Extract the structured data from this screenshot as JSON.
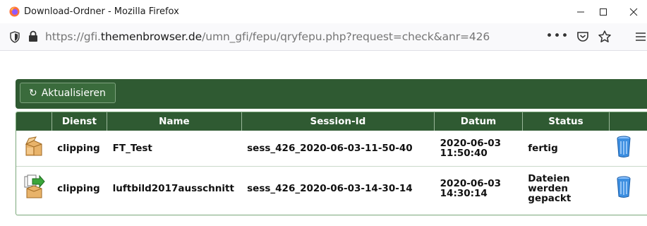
{
  "window": {
    "title": "Download-Ordner - Mozilla Firefox",
    "controls": {
      "minimize": "—",
      "maximize": "☐",
      "close": "✕"
    }
  },
  "urlbar": {
    "url_prefix": "https://gfi.",
    "url_domain": "themenbrowser.de",
    "url_path": "/umn_gfi/fepu/qryfepu.php?request=check&anr=426",
    "more": "•••",
    "pocket_icon": "pocket-icon",
    "star_icon": "star-icon",
    "menu_icon": "hamburger-menu-icon"
  },
  "toolbar": {
    "refresh_label": "Aktualisieren",
    "refresh_icon": "↻"
  },
  "table": {
    "headers": [
      "",
      "Dienst",
      "Name",
      "Session-Id",
      "Datum",
      "Status",
      ""
    ],
    "rows": [
      {
        "icon": "package-icon",
        "dienst": "clipping",
        "name": "FT_Test",
        "session_id": "sess_426_2020-06-03-11-50-40",
        "datum_date": "2020-06-03",
        "datum_time": "11:50:40",
        "status_lines": [
          "fertig",
          "",
          ""
        ],
        "delete_icon": "trash-icon"
      },
      {
        "icon": "packing-in-progress-icon",
        "dienst": "clipping",
        "name": "luftbild2017ausschnitt",
        "session_id": "sess_426_2020-06-03-14-30-14",
        "datum_date": "2020-06-03",
        "datum_time": "14:30:14",
        "status_lines": [
          "Dateien",
          "werden",
          "gepackt"
        ],
        "delete_icon": "trash-icon"
      }
    ]
  },
  "colors": {
    "toolbar_green": "#2f5a32",
    "header_green": "#2f5a32",
    "border_green": "#7aa77a",
    "trash_blue": "#2f7fd1"
  }
}
